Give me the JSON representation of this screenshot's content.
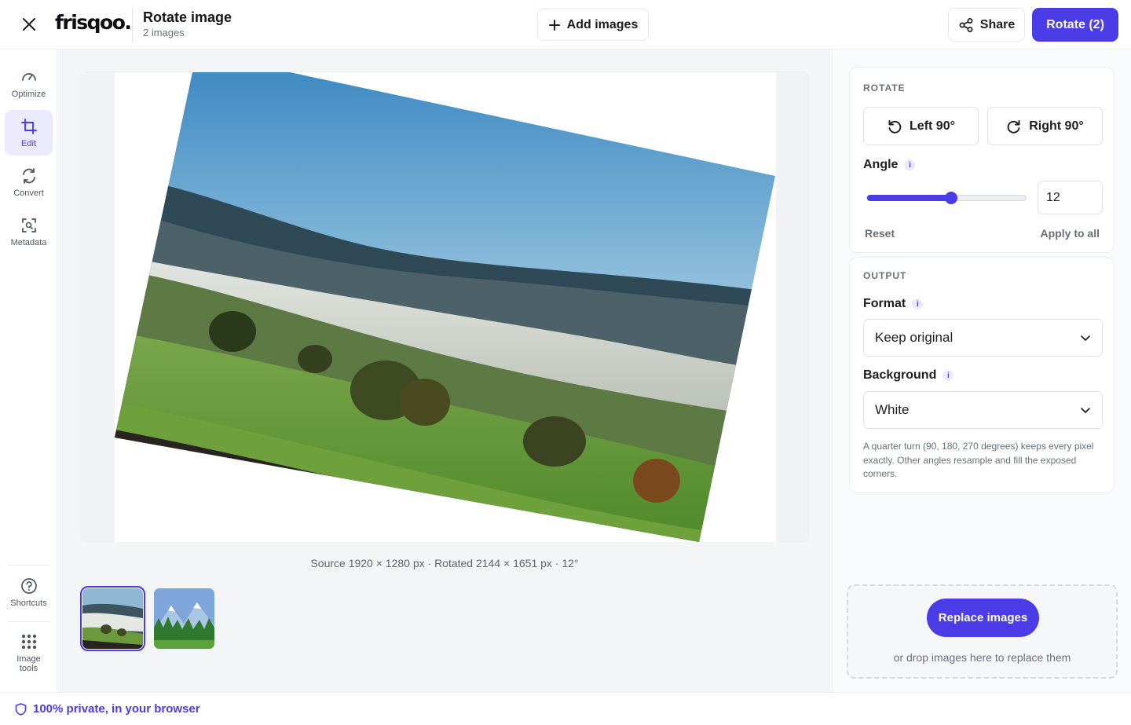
{
  "header": {
    "logo_text": "frisqoo",
    "logo_dot": ".",
    "title": "Rotate image",
    "subtitle": "2 images",
    "add_images_label": "Add images",
    "share_label": "Share",
    "rotate_label": "Rotate (2)"
  },
  "sidebar": {
    "items": [
      {
        "label": "Optimize",
        "icon": "gauge-icon"
      },
      {
        "label": "Edit",
        "icon": "crop-icon",
        "active": true
      },
      {
        "label": "Convert",
        "icon": "refresh-icon"
      },
      {
        "label": "Metadata",
        "icon": "scan-icon"
      }
    ],
    "bottom": [
      {
        "label": "Shortcuts",
        "icon": "question-icon"
      },
      {
        "label": "Image tools",
        "icon": "grid-dots-icon"
      }
    ]
  },
  "canvas": {
    "caption": "Source 1920 × 1280 px · Rotated 2144 × 1651 px · 12°",
    "rotation_degrees": 12
  },
  "rotate_panel": {
    "section_label": "ROTATE",
    "left_label": "Left 90°",
    "right_label": "Right 90°",
    "angle_label": "Angle",
    "info_glyph": "i",
    "angle_value": "12",
    "slider_fraction": 0.53,
    "reset_label": "Reset",
    "apply_all_label": "Apply to all"
  },
  "output_panel": {
    "section_label": "OUTPUT",
    "format_label": "Format",
    "format_value": "Keep original",
    "background_label": "Background",
    "background_value": "White",
    "note": "A quarter turn (90, 180, 270 degrees) keeps every pixel exactly. Other angles resample and fill the exposed corners."
  },
  "drop_zone": {
    "button_label": "Replace images",
    "text": "or drop images here to replace them"
  },
  "footer": {
    "text": "100% private, in your browser"
  },
  "colors": {
    "accent": "#4b3ce8",
    "accent_light": "#eceaff"
  }
}
